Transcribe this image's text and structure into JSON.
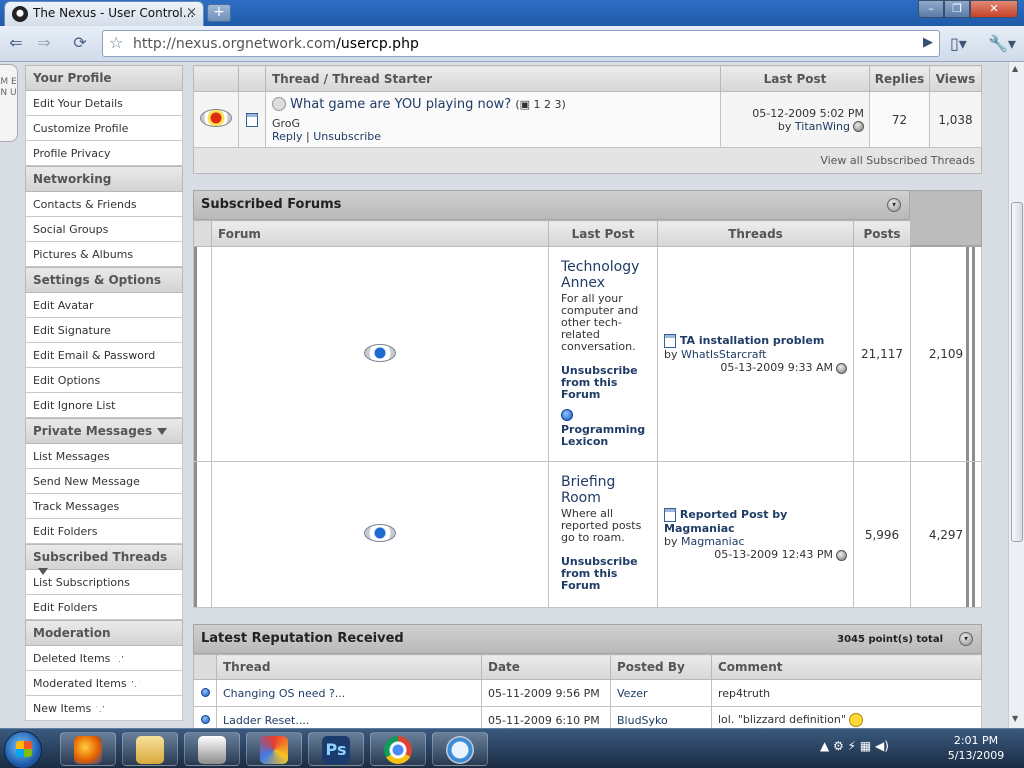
{
  "browser": {
    "tab_title": "The Nexus - User Control...",
    "new_tab_symbol": "+",
    "url_host": "http://nexus.orgnetwork.com",
    "url_path": "/usercp.php",
    "window_controls": {
      "min": "–",
      "max": "❐",
      "close": "✕"
    },
    "icons": [
      "back-icon",
      "forward-icon",
      "reload-icon",
      "star-icon",
      "go-icon",
      "page-menu-icon",
      "wrench-icon"
    ]
  },
  "sidebar": {
    "menu_tab": "M E N U",
    "sections": [
      {
        "title": "Your Profile",
        "items": [
          "Edit Your Details",
          "Customize Profile",
          "Profile Privacy"
        ]
      },
      {
        "title": "Networking",
        "items": [
          "Contacts & Friends",
          "Social Groups",
          "Pictures & Albums"
        ]
      },
      {
        "title": "Settings & Options",
        "items": [
          "Edit Avatar",
          "Edit Signature",
          "Edit Email & Password",
          "Edit Options",
          "Edit Ignore List"
        ]
      },
      {
        "title": "Private Messages",
        "dropdown": true,
        "items": [
          "List Messages",
          "Send New Message",
          "Track Messages",
          "Edit Folders"
        ]
      },
      {
        "title": "Subscribed Threads",
        "dropdown": true,
        "items": [
          "List Subscriptions",
          "Edit Folders"
        ]
      },
      {
        "title": "Moderation",
        "items": [
          "Deleted Items",
          "Moderated Items",
          "New Items"
        ]
      }
    ]
  },
  "threads": {
    "headers": {
      "thread": "Thread / Thread Starter",
      "last_post": "Last Post",
      "replies": "Replies",
      "views": "Views"
    },
    "row": {
      "title": "What game are YOU playing now?",
      "pages": "1 2 3",
      "starter": "GroG",
      "reply": "Reply",
      "sep": "|",
      "unsubscribe": "Unsubscribe",
      "last_post_date": "05-12-2009",
      "last_post_time": "5:02 PM",
      "last_post_by_prefix": "by",
      "last_post_by": "TitanWing",
      "replies": "72",
      "views": "1,038"
    },
    "view_all": "View all Subscribed Threads"
  },
  "forums": {
    "title": "Subscribed Forums",
    "headers": {
      "forum": "Forum",
      "last_post": "Last Post",
      "threads": "Threads",
      "posts": "Posts"
    },
    "rows": [
      {
        "name": "Technology Annex",
        "description": "For all your computer and other tech-related conversation.",
        "unsubscribe": "Unsubscribe from this Forum",
        "subforum": "Programming Lexicon",
        "last_post_title": "TA installation problem",
        "last_post_by_prefix": "by",
        "last_post_by": "WhatIsStarcraft",
        "last_post_date": "05-13-2009",
        "last_post_time": "9:33 AM",
        "threads": "21,117",
        "posts": "2,109"
      },
      {
        "name": "Briefing Room",
        "description": "Where all reported posts go to roam.",
        "unsubscribe": "Unsubscribe from this Forum",
        "last_post_title": "Reported Post by Magmaniac",
        "last_post_by_prefix": "by",
        "last_post_by": "Magmaniac",
        "last_post_date": "05-13-2009",
        "last_post_time": "12:43 PM",
        "threads": "5,996",
        "posts": "4,297"
      }
    ]
  },
  "reputation": {
    "title": "Latest Reputation Received",
    "total": "3045 point(s) total",
    "headers": {
      "thread": "Thread",
      "date": "Date",
      "posted_by": "Posted By",
      "comment": "Comment"
    },
    "rows": [
      {
        "thread": "Changing OS need ?...",
        "date": "05-11-2009",
        "time": "9:56 PM",
        "posted_by": "Vezer",
        "comment": "rep4truth"
      },
      {
        "thread": "Ladder Reset....",
        "date": "05-11-2009",
        "time": "6:10 PM",
        "posted_by": "BludSyko",
        "comment": "lol. \"blizzard definition\""
      }
    ]
  },
  "taskbar": {
    "programs": [
      "firefox-icon",
      "explorer-icon",
      "media-player-icon",
      "paint-icon",
      "photoshop-icon",
      "chrome-icon",
      "safari-icon"
    ],
    "photoshop_label": "Ps",
    "time": "2:01 PM",
    "date": "5/13/2009"
  }
}
